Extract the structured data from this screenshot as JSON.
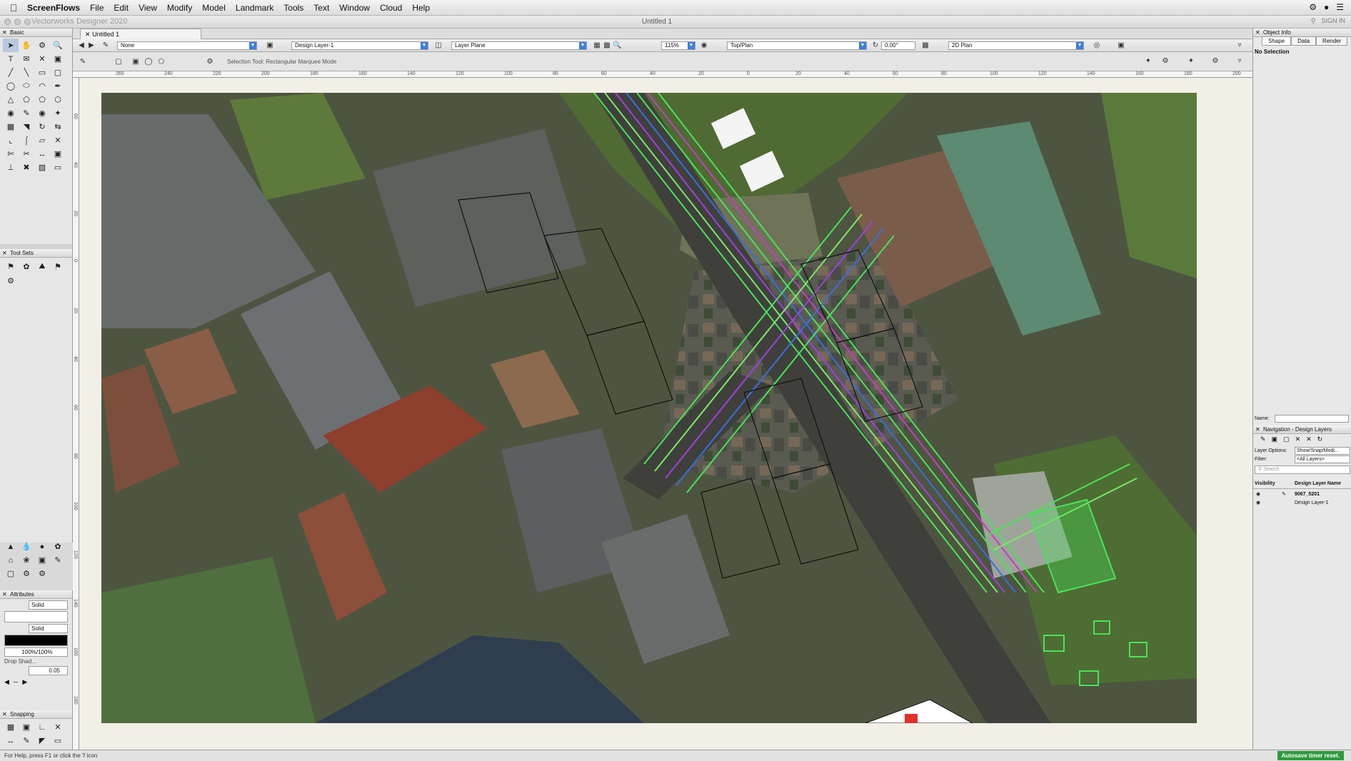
{
  "menubar": {
    "app_name": "ScreenFlows",
    "items": [
      "File",
      "Edit",
      "View",
      "Modify",
      "Model",
      "Landmark",
      "Tools",
      "Text",
      "Window",
      "Cloud",
      "Help"
    ]
  },
  "window": {
    "app_title": "Vectorworks Designer 2020",
    "doc_title": "Untitled 1",
    "tab_label": "Untitled 1",
    "sign_in": "SIGN IN"
  },
  "view_bar": {
    "class": "None",
    "layer": "Design Layer-1",
    "plane": "Layer Plane",
    "zoom": "115%",
    "view": "Top/Plan",
    "rotation": "0.00°",
    "render_mode": "2D Plan"
  },
  "mode_bar": {
    "hint": "Selection Tool: Rectangular Marquee Mode"
  },
  "palettes": {
    "basic_title": "Basic",
    "toolsets_title": "Tool Sets",
    "attributes_title": "Attributes",
    "fill_style": "Solid",
    "pen_style": "Solid",
    "opacity": "100%/100%",
    "drop_shadow": "Drop Shad...",
    "line_weight": "0.05",
    "snapping_title": "Snapping"
  },
  "rulers": {
    "horizontal": [
      "260",
      "240",
      "220",
      "200",
      "180",
      "160",
      "140",
      "120",
      "100",
      "80",
      "60",
      "40",
      "20",
      "0",
      "20",
      "40",
      "60",
      "80",
      "100",
      "120",
      "140",
      "160",
      "180",
      "200"
    ],
    "vertical": [
      "60",
      "40",
      "20",
      "0",
      "20",
      "40",
      "60",
      "80",
      "100",
      "120",
      "140",
      "160",
      "180"
    ]
  },
  "object_info": {
    "title": "Object Info",
    "tabs": [
      "Shape",
      "Data",
      "Render"
    ],
    "selection": "No Selection",
    "name_label": "Name:"
  },
  "navigation": {
    "title": "Navigation - Design Layers",
    "layer_options_label": "Layer Options:",
    "layer_options_value": "Show/Snap/Modi...",
    "filter_label": "Filter:",
    "filter_value": "<All Layers>",
    "search_placeholder": "Search",
    "col_visibility": "Visibility",
    "col_name": "Design Layer Name",
    "layers": [
      "9067_5201",
      "Design Layer-1"
    ]
  },
  "status": {
    "help": "For Help, press F1 or click the ? icon",
    "autosave": "Autosave timer reset."
  },
  "colors": {
    "accent_blue": "#3a7fe0",
    "autosave_green": "#2e9a3d",
    "plan_green": "#49e35a",
    "plan_purple": "#a040e0"
  }
}
